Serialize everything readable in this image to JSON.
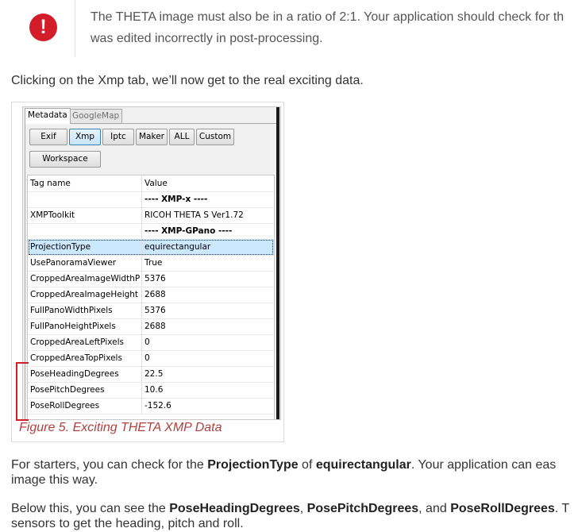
{
  "callout": {
    "icon": "exclamation-circle-icon",
    "icon_glyph": "!",
    "line1": "The THETA image must also be in a ratio of 2:1. Your application should check for th",
    "line2": "was edited incorrectly in post-processing."
  },
  "intro": "Clicking on the Xmp tab, we’ll now get to the real exciting data.",
  "screenshot": {
    "tabs": [
      "Metadata",
      "GoogleMap"
    ],
    "buttons": [
      "Exif",
      "Xmp",
      "Iptc",
      "Maker",
      "ALL",
      "Custom"
    ],
    "workspace": "Workspace",
    "columns": [
      "Tag name",
      "Value"
    ],
    "rows": [
      {
        "tag": "",
        "value": "---- XMP-x ----"
      },
      {
        "tag": "XMPToolkit",
        "value": "RICOH THETA S Ver1.72"
      },
      {
        "tag": "",
        "value": "---- XMP-GPano ----"
      },
      {
        "tag": "ProjectionType",
        "value": "equirectangular"
      },
      {
        "tag": "UsePanoramaViewer",
        "value": "True"
      },
      {
        "tag": "CroppedAreaImageWidthPixels",
        "value": "5376"
      },
      {
        "tag": "CroppedAreaImageHeight",
        "value": "2688"
      },
      {
        "tag": "FullPanoWidthPixels",
        "value": "5376"
      },
      {
        "tag": "FullPanoHeightPixels",
        "value": "2688"
      },
      {
        "tag": "CroppedAreaLeftPixels",
        "value": "0"
      },
      {
        "tag": "CroppedAreaTopPixels",
        "value": "0"
      },
      {
        "tag": "PoseHeadingDegrees",
        "value": "22.5"
      },
      {
        "tag": "PosePitchDegrees",
        "value": "10.6"
      },
      {
        "tag": "PoseRollDegrees",
        "value": "-152.6"
      }
    ],
    "selected_tag": "ProjectionType"
  },
  "caption": "Figure 5. Exciting THETA XMP Data",
  "para2": {
    "t1": "For starters, you can check for the ",
    "b1": "ProjectionType",
    "t2": " of ",
    "b2": "equirectangular",
    "t3": ". Your application can eas",
    "line2": "image this way."
  },
  "para3": {
    "t1": "Below this, you can see the ",
    "b1": "PoseHeadingDegrees",
    "t2": ", ",
    "b2": "PosePitchDegrees",
    "t3": ", and ",
    "b3": "PoseRollDegrees",
    "t4": ". T",
    "line2": "sensors to get the heading, pitch and roll."
  },
  "colors": {
    "accent_red": "#d21d2b",
    "caption": "#b0413e",
    "selection": "#cce8ff"
  }
}
